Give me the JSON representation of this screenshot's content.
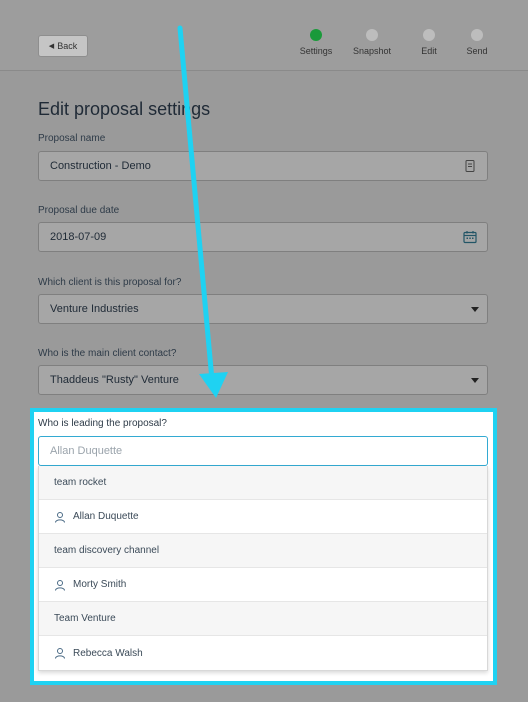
{
  "header": {
    "back_label": "Back",
    "steps": [
      {
        "label": "Settings",
        "active": true
      },
      {
        "label": "Snapshot",
        "active": false
      },
      {
        "label": "Edit",
        "active": false
      },
      {
        "label": "Send",
        "active": false
      }
    ]
  },
  "form": {
    "title": "Edit proposal settings",
    "proposal_name_label": "Proposal name",
    "proposal_name_value": "Construction - Demo",
    "due_date_label": "Proposal due date",
    "due_date_value": "2018-07-09",
    "client_label": "Which client is this proposal for?",
    "client_value": "Venture Industries",
    "contact_label": "Who is the main client contact?",
    "contact_value": "Thaddeus \"Rusty\" Venture",
    "lead_label": "Who is leading the proposal?",
    "lead_placeholder": "Allan Duquette"
  },
  "dropdown": {
    "items": [
      {
        "label": "team rocket",
        "type": "team"
      },
      {
        "label": "Allan Duquette",
        "type": "user"
      },
      {
        "label": "team discovery channel",
        "type": "team"
      },
      {
        "label": "Morty Smith",
        "type": "user"
      },
      {
        "label": "Team Venture",
        "type": "team"
      },
      {
        "label": "Rebecca Walsh",
        "type": "user"
      }
    ]
  },
  "colors": {
    "highlight": "#1fd2f2",
    "active_step": "#1a9a3a",
    "overlay": "#9a9a9a"
  }
}
